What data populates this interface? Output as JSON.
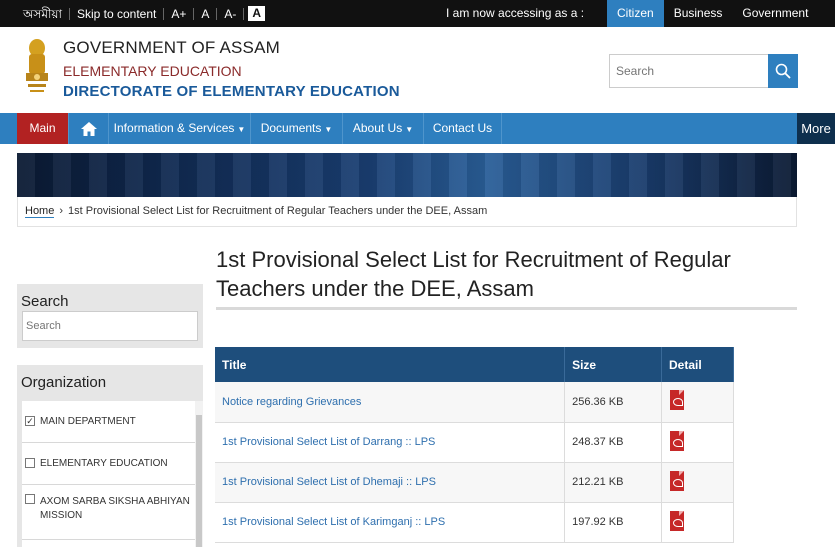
{
  "topbar": {
    "lang": "অসমীয়া",
    "skip": "Skip to content",
    "font_plus": "A+",
    "font_normal": "A",
    "font_minus": "A-",
    "contrast": "A",
    "accessing": "I am now accessing as a :",
    "roles": [
      "Citizen",
      "Business",
      "Government"
    ]
  },
  "header": {
    "line1": "GOVERNMENT OF ASSAM",
    "line2": "ELEMENTARY EDUCATION",
    "line3": "DIRECTORATE OF ELEMENTARY EDUCATION",
    "search_placeholder": "Search"
  },
  "nav": {
    "main": "Main",
    "info": "Information & Services",
    "docs": "Documents",
    "about": "About Us",
    "contact": "Contact Us",
    "more": "More"
  },
  "breadcrumb": {
    "home": "Home",
    "current": "1st Provisional Select List for Recruitment of Regular Teachers under the DEE, Assam"
  },
  "sidebar": {
    "search_title": "Search",
    "search_placeholder": "Search",
    "org_title": "Organization",
    "org_items": [
      "MAIN DEPARTMENT",
      "ELEMENTARY EDUCATION",
      "AXOM SARBA SIKSHA ABHIYAN MISSION"
    ]
  },
  "content": {
    "title": "1st Provisional Select List for Recruitment of Regular Teachers under the DEE, Assam",
    "table_headers": [
      "Title",
      "Size",
      "Detail"
    ],
    "rows": [
      {
        "title": "Notice regarding Grievances",
        "size": "256.36 KB"
      },
      {
        "title": "1st Provisional Select List of Darrang :: LPS",
        "size": "248.37 KB"
      },
      {
        "title": "1st Provisional Select List of Dhemaji :: LPS",
        "size": "212.21 KB"
      },
      {
        "title": "1st Provisional Select List of Karimganj :: LPS",
        "size": "197.92 KB"
      }
    ]
  },
  "colors": {
    "nav_blue": "#2e7fbf",
    "main_red": "#b22222",
    "table_header": "#1e4e7c",
    "link": "#2e6fae"
  },
  "icons": [
    "search-icon",
    "home-icon",
    "pdf-icon",
    "checkbox-icon",
    "emblem-icon"
  ]
}
